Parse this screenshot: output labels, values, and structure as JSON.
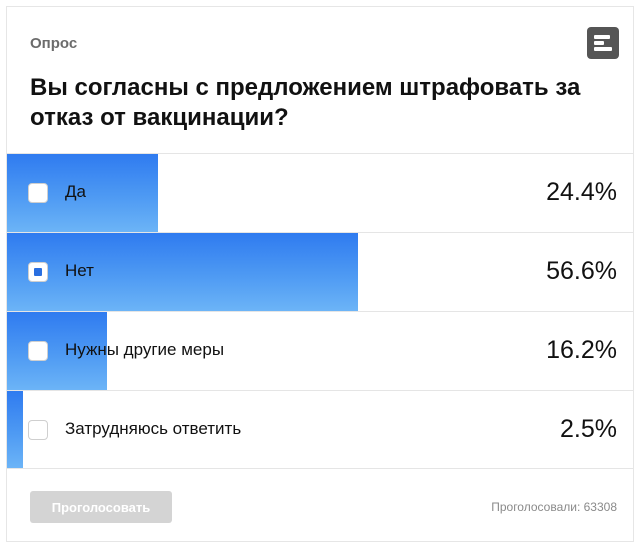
{
  "poll": {
    "label": "Опрос",
    "icon": "bar-chart-icon",
    "question": "Вы согласны с предложением штрафовать за отказ от вакцинации?",
    "options": [
      {
        "label": "Да",
        "percent": "24.4%",
        "fill": 0.244,
        "selected": false
      },
      {
        "label": "Нет",
        "percent": "56.6%",
        "fill": 0.566,
        "selected": true
      },
      {
        "label": "Нужны другие меры",
        "percent": "16.2%",
        "fill": 0.162,
        "selected": false
      },
      {
        "label": "Затрудняюсь ответить",
        "percent": "2.5%",
        "fill": 0.025,
        "selected": false
      }
    ],
    "vote_label": "Проголосовать",
    "voted_text": "Проголосовали:  63308"
  },
  "colors": {
    "bar_top": "#2f7bf0",
    "bar_bottom": "#6cb4f7",
    "button_disabled": "#d4d4d4"
  }
}
